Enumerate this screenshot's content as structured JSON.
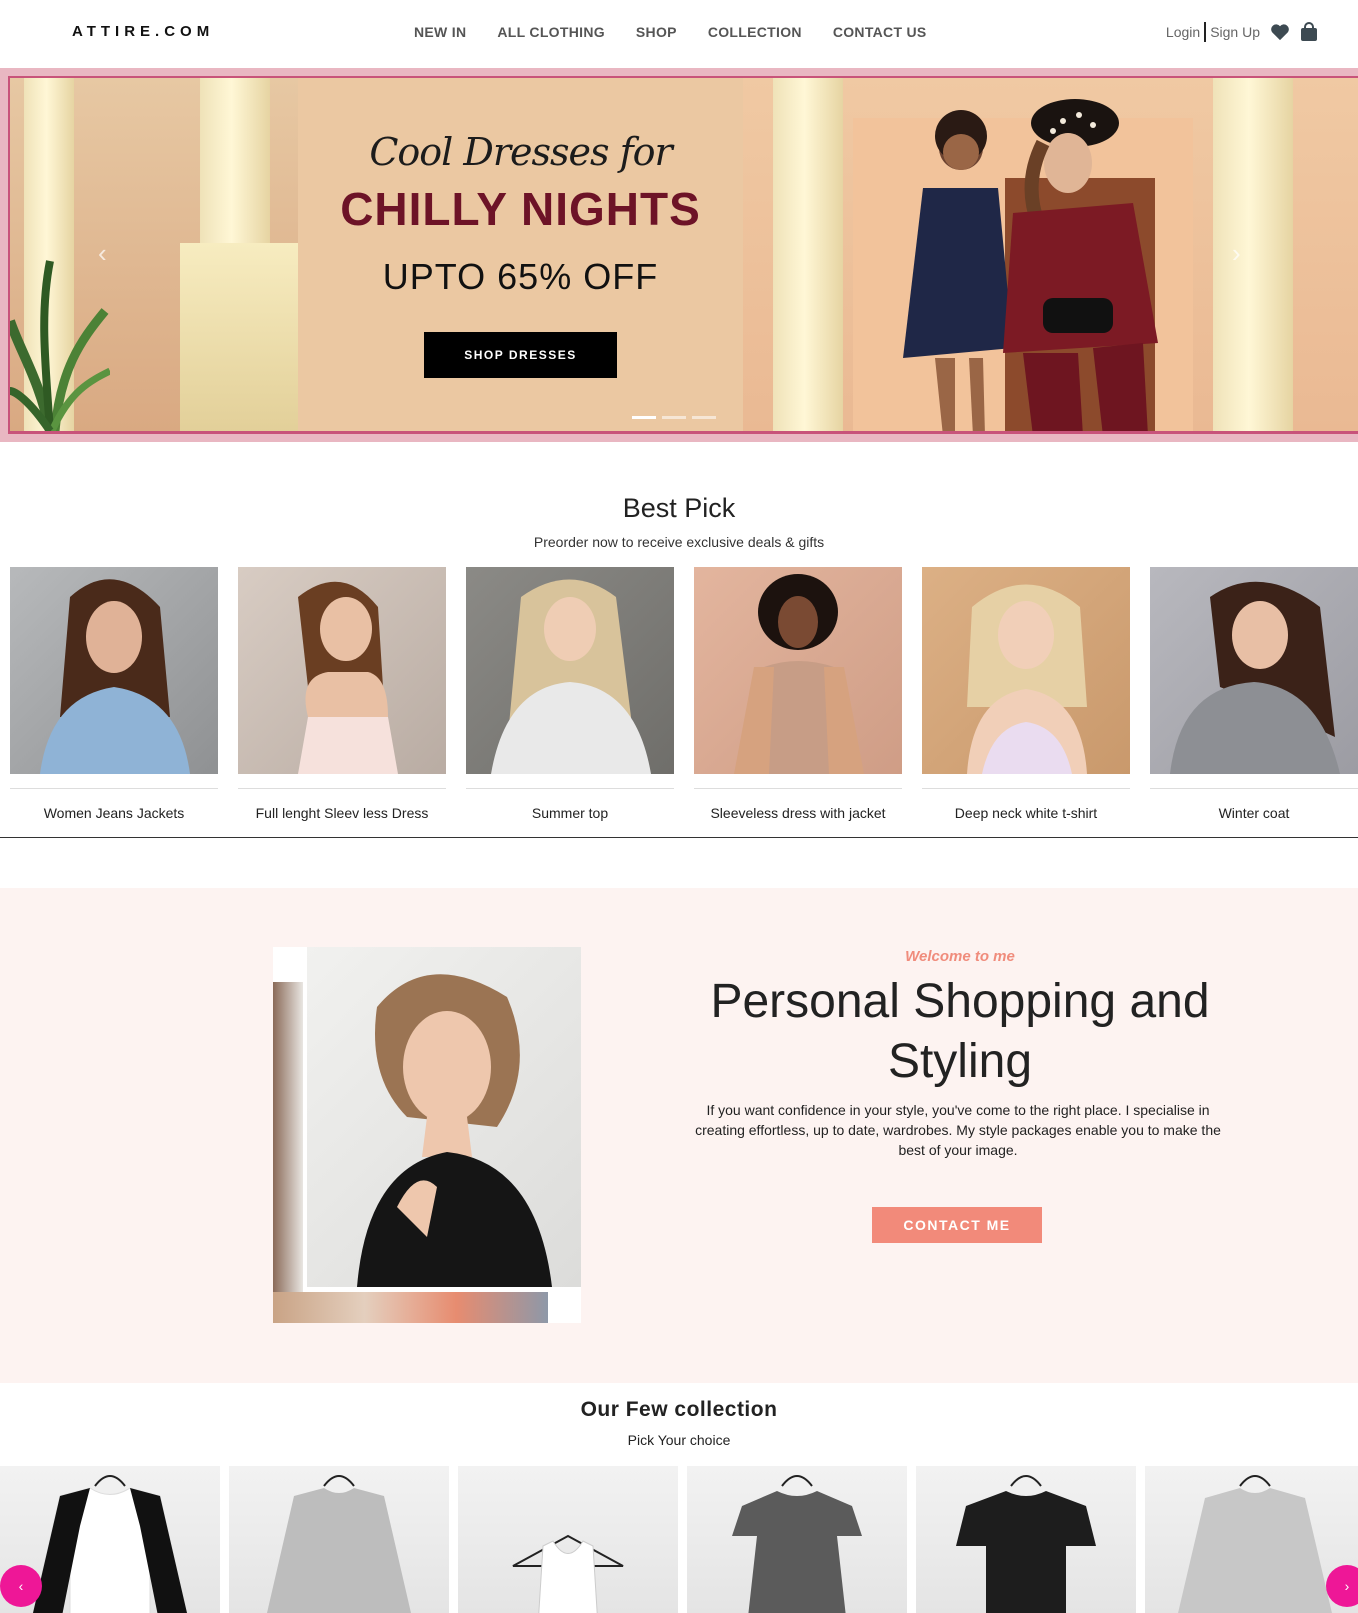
{
  "brand": {
    "logo": "ATTIRE.COM"
  },
  "nav": {
    "items": [
      {
        "label": "NEW IN"
      },
      {
        "label": "ALL CLOTHING"
      },
      {
        "label": "SHOP"
      },
      {
        "label": "COLLECTION"
      },
      {
        "label": "CONTACT US"
      }
    ]
  },
  "auth": {
    "login": "Login",
    "signup": "Sign Up",
    "wishlist_icon": "heart-icon",
    "cart_icon": "shopping-bag-icon"
  },
  "hero": {
    "script_line": "Cool Dresses for",
    "headline": "CHILLY NIGHTS",
    "offer": "UPTO 65% OFF",
    "button": "SHOP DRESSES",
    "slides": 3,
    "active_slide": 1,
    "colors": {
      "headline": "#6d1327",
      "panel": "#ebc8a2"
    }
  },
  "best_pick": {
    "title": "Best Pick",
    "subtitle": "Preorder now to receive exclusive deals & gifts",
    "items": [
      {
        "label": "Women Jeans Jackets"
      },
      {
        "label": "Full lenght Sleev less Dress"
      },
      {
        "label": "Summer top"
      },
      {
        "label": "Sleeveless dress with jacket"
      },
      {
        "label": "Deep neck white t-shirt"
      },
      {
        "label": "Winter coat"
      }
    ]
  },
  "personal": {
    "welcome": "Welcome to me",
    "title": "Personal Shopping and Styling",
    "text": "If you want confidence in your style, you've come to the right place. I specialise in creating effortless, up to date, wardrobes. My style packages enable you to make the best of your image.",
    "button": "CONTACT ME",
    "colors": {
      "accent": "#f28a7a",
      "background": "#fdf3f1"
    }
  },
  "collection": {
    "title": "Our Few collection",
    "subtitle": "Pick Your choice",
    "prev": "‹",
    "next": "›",
    "colors": {
      "nav_button": "#ee1797"
    }
  }
}
